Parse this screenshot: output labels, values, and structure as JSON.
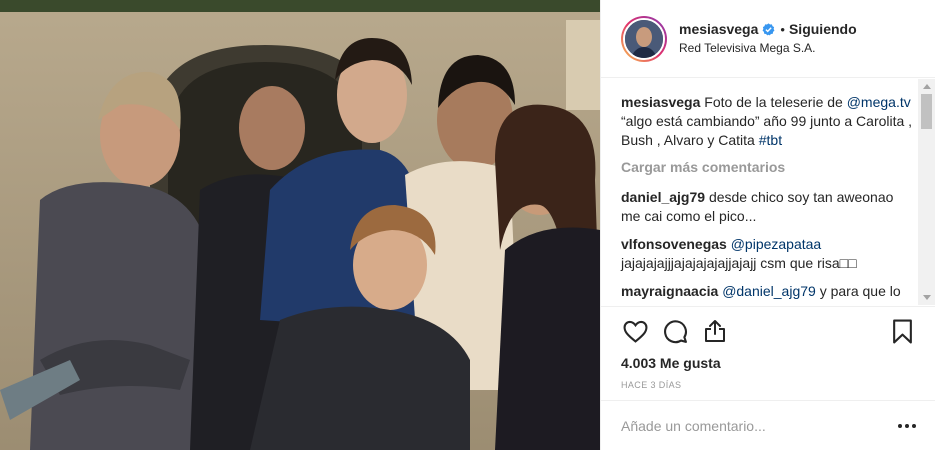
{
  "post": {
    "username": "mesiasvega",
    "separator": "•",
    "follow_label": "Siguiendo",
    "location": "Red Televisiva Mega S.A."
  },
  "caption": {
    "username": "mesiasvega",
    "text_before": "Foto de la teleserie de",
    "mention": "@mega.tv",
    "text_after": "“algo está cambiando” año 99 junto a Carolita , Bush , Alvaro y Catita",
    "hashtag": "#tbt"
  },
  "load_more": "Cargar más comentarios",
  "comments": [
    {
      "username": "daniel_ajg79",
      "text": "desde chico soy tan aweonao me cai como el pico..."
    },
    {
      "username": "vlfonsovenegas",
      "mention": "@pipezapataa",
      "text": "jajajajajjjajajajajajjajajj csm que risa□□"
    },
    {
      "username": "mayraignaacia",
      "mention": "@daniel_ajg79",
      "text": "y para que lo sigues entonces?"
    }
  ],
  "likes": "4.003 Me gusta",
  "timestamp": "HACE 3 DÍAS",
  "comment_input": {
    "placeholder": "Añade un comentario..."
  },
  "icons": {
    "verified": "verified-badge-icon",
    "like": "heart-icon",
    "comment": "comment-bubble-icon",
    "share": "share-icon",
    "save": "bookmark-icon",
    "more": "more-options-icon"
  },
  "colors": {
    "verified": "#3897f0",
    "mention": "#003569",
    "muted": "#999999",
    "text": "#262626"
  }
}
